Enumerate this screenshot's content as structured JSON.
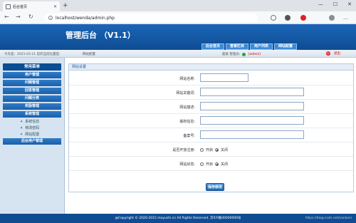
{
  "browser": {
    "tab_title": "后台首页",
    "url": "localhost/wenda/admin.php"
  },
  "header": {
    "title": "管理后台 （V1.1）",
    "nav": [
      "后台首页",
      "查看栏目",
      "用户列表",
      "网站配置"
    ]
  },
  "status": {
    "date_text": "今天是：2021-03-11 您的当前位置是:",
    "location": "网站配置",
    "role_label": "超级 管理员:",
    "username": "[admin]",
    "logout": "退出"
  },
  "sidebar": {
    "head": "常用菜单",
    "items": [
      "用户管理",
      "问题管理",
      "回答管理",
      "问题分类",
      "奖励管理",
      "系统管理"
    ],
    "sub_items": [
      "系统信息",
      "修改密码",
      "网站配置"
    ],
    "last_item": "后台用户管理"
  },
  "panel": {
    "title": "网站设置",
    "fields": [
      {
        "label": "网站名称:",
        "value": ""
      },
      {
        "label": "网站关键词:",
        "value": ""
      },
      {
        "label": "网站描述:",
        "value": ""
      },
      {
        "label": "版权信息:",
        "value": ""
      },
      {
        "label": "备案号:",
        "value": ""
      }
    ],
    "register_label": "是否开放注册:",
    "status_label": "网站状态:",
    "on_label": "开启",
    "off_label": "关闭",
    "save": "保存修改"
  },
  "footer": {
    "text": "@Copyright © 2020-2015 moyushi.cn All Rights Reserved. 京ICP备00000000号",
    "watermark": "https://blog.csdn.net/sankeni"
  }
}
